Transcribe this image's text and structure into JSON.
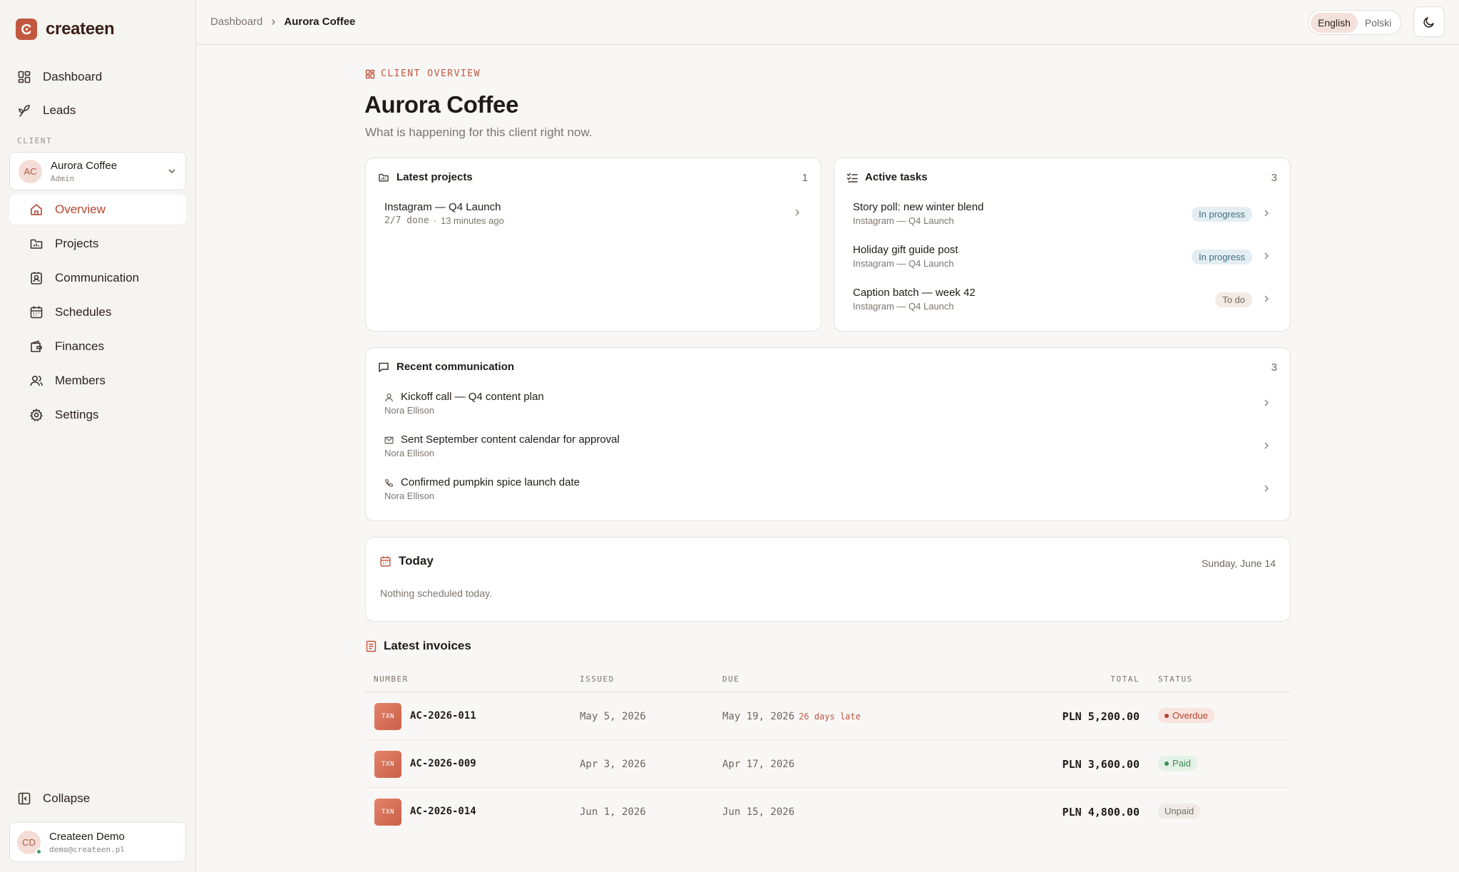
{
  "brand": {
    "name": "createen"
  },
  "sidebar": {
    "top_items": [
      {
        "label": "Dashboard",
        "icon": "grid-icon"
      },
      {
        "label": "Leads",
        "icon": "sprout-icon"
      }
    ],
    "section_label": "CLIENT",
    "client": {
      "initials": "AC",
      "name": "Aurora Coffee",
      "role": "Admin"
    },
    "client_items": [
      {
        "label": "Overview",
        "icon": "home-icon",
        "active": true
      },
      {
        "label": "Projects",
        "icon": "folder-chart-icon"
      },
      {
        "label": "Communication",
        "icon": "contact-icon"
      },
      {
        "label": "Schedules",
        "icon": "calendar-icon"
      },
      {
        "label": "Finances",
        "icon": "wallet-icon"
      },
      {
        "label": "Members",
        "icon": "users-icon"
      },
      {
        "label": "Settings",
        "icon": "gear-icon"
      }
    ],
    "collapse_label": "Collapse",
    "user": {
      "initials": "CD",
      "name": "Createen Demo",
      "email": "demo@createen.pl"
    }
  },
  "topbar": {
    "breadcrumb": [
      "Dashboard",
      "Aurora Coffee"
    ],
    "languages": [
      "English",
      "Polski"
    ],
    "selected_language": "English"
  },
  "header": {
    "eyebrow": "CLIENT OVERVIEW",
    "title": "Aurora Coffee",
    "subtitle": "What is happening for this client right now."
  },
  "projects": {
    "title": "Latest projects",
    "count": "1",
    "items": [
      {
        "name": "Instagram — Q4 Launch",
        "progress": "2/7 done",
        "sep": "·",
        "time": "13 minutes ago"
      }
    ]
  },
  "tasks": {
    "title": "Active tasks",
    "count": "3",
    "items": [
      {
        "title": "Story poll: new winter blend",
        "project": "Instagram — Q4 Launch",
        "status": "In progress"
      },
      {
        "title": "Holiday gift guide post",
        "project": "Instagram — Q4 Launch",
        "status": "In progress"
      },
      {
        "title": "Caption batch — week 42",
        "project": "Instagram — Q4 Launch",
        "status": "To do"
      }
    ]
  },
  "communication": {
    "title": "Recent communication",
    "count": "3",
    "items": [
      {
        "title": "Kickoff call — Q4 content plan",
        "author": "Nora Ellison",
        "icon": "person-icon"
      },
      {
        "title": "Sent September content calendar for approval",
        "author": "Nora Ellison",
        "icon": "mail-icon"
      },
      {
        "title": "Confirmed pumpkin spice launch date",
        "author": "Nora Ellison",
        "icon": "phone-icon"
      }
    ]
  },
  "today": {
    "title": "Today",
    "date": "Sunday, June 14",
    "empty": "Nothing scheduled today."
  },
  "invoices": {
    "title": "Latest invoices",
    "columns": {
      "number": "NUMBER",
      "issued": "ISSUED",
      "due": "DUE",
      "total": "TOTAL",
      "status": "STATUS"
    },
    "rows": [
      {
        "badge": "TXN",
        "number": "AC-2026-011",
        "issued": "May 5, 2026",
        "due": "May 19, 2026",
        "late": "26 days late",
        "total": "PLN 5,200.00",
        "status": "Overdue"
      },
      {
        "badge": "TXN",
        "number": "AC-2026-009",
        "issued": "Apr 3, 2026",
        "due": "Apr 17, 2026",
        "late": "",
        "total": "PLN 3,600.00",
        "status": "Paid"
      },
      {
        "badge": "TXN",
        "number": "AC-2026-014",
        "issued": "Jun 1, 2026",
        "due": "Jun 15, 2026",
        "late": "",
        "total": "PLN 4,800.00",
        "status": "Unpaid"
      }
    ]
  },
  "colors": {
    "accent": "#c2573f",
    "paid": "#3f8a55",
    "in_progress": "#3f6f80"
  }
}
